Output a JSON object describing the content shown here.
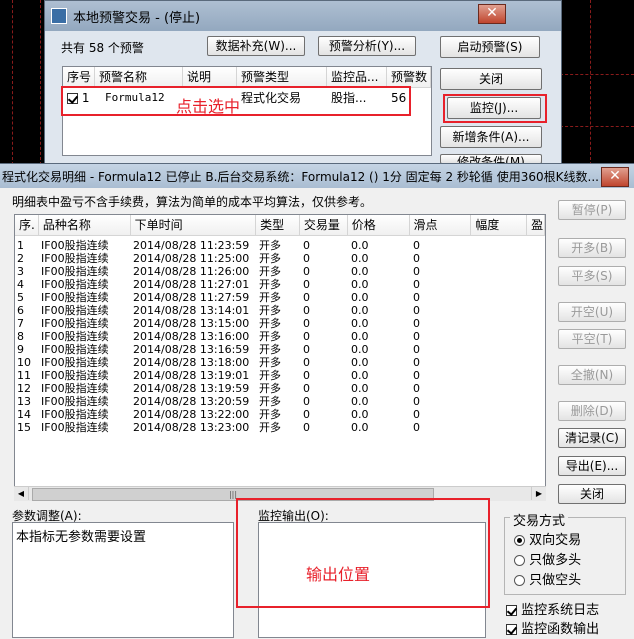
{
  "bg_window": {
    "title": "本地预警交易 - (停止)",
    "count_text": "共有 58 个预警",
    "buttons": {
      "data_fill": "数据补充(W)...",
      "alert_analysis": "预警分析(Y)...",
      "start_alert": "启动预警(S)",
      "close": "关闭",
      "monitor": "监控(J)...",
      "add_condition": "新增条件(A)...",
      "modify_condition": "修改条件(M)"
    },
    "columns": [
      "序号",
      "预警名称",
      "说明",
      "预警类型",
      "监控品...",
      "预警数"
    ],
    "row": {
      "num": "1",
      "name": "Formula12",
      "desc": "",
      "type": "程式化交易",
      "product": "股指...",
      "count": "56"
    },
    "annotation": "点击选中",
    "close_icon": "close-x-icon"
  },
  "fg_window": {
    "title": "程式化交易明细 - Formula12 已停止  B.后台交易系统：Formula12 () 1分 固定每 2 秒轮循 使用360根K线数...",
    "notice": "明细表中盈亏不含手续费，算法为简单的成本平均算法，仅供参考。",
    "columns": [
      "序.",
      "品种名称",
      "下单时间",
      "类型",
      "交易量",
      "价格",
      "滑点",
      "幅度",
      "盈"
    ],
    "rows": [
      [
        "1",
        "IF00股指连续",
        "2014/08/28 11:23:59",
        "开多",
        "0",
        "0.0",
        "0"
      ],
      [
        "2",
        "IF00股指连续",
        "2014/08/28 11:25:00",
        "开多",
        "0",
        "0.0",
        "0"
      ],
      [
        "3",
        "IF00股指连续",
        "2014/08/28 11:26:00",
        "开多",
        "0",
        "0.0",
        "0"
      ],
      [
        "4",
        "IF00股指连续",
        "2014/08/28 11:27:01",
        "开多",
        "0",
        "0.0",
        "0"
      ],
      [
        "5",
        "IF00股指连续",
        "2014/08/28 11:27:59",
        "开多",
        "0",
        "0.0",
        "0"
      ],
      [
        "6",
        "IF00股指连续",
        "2014/08/28 13:14:01",
        "开多",
        "0",
        "0.0",
        "0"
      ],
      [
        "7",
        "IF00股指连续",
        "2014/08/28 13:15:00",
        "开多",
        "0",
        "0.0",
        "0"
      ],
      [
        "8",
        "IF00股指连续",
        "2014/08/28 13:16:00",
        "开多",
        "0",
        "0.0",
        "0"
      ],
      [
        "9",
        "IF00股指连续",
        "2014/08/28 13:16:59",
        "开多",
        "0",
        "0.0",
        "0"
      ],
      [
        "10",
        "IF00股指连续",
        "2014/08/28 13:18:00",
        "开多",
        "0",
        "0.0",
        "0"
      ],
      [
        "11",
        "IF00股指连续",
        "2014/08/28 13:19:01",
        "开多",
        "0",
        "0.0",
        "0"
      ],
      [
        "12",
        "IF00股指连续",
        "2014/08/28 13:19:59",
        "开多",
        "0",
        "0.0",
        "0"
      ],
      [
        "13",
        "IF00股指连续",
        "2014/08/28 13:20:59",
        "开多",
        "0",
        "0.0",
        "0"
      ],
      [
        "14",
        "IF00股指连续",
        "2014/08/28 13:22:00",
        "开多",
        "0",
        "0.0",
        "0"
      ],
      [
        "15",
        "IF00股指连续",
        "2014/08/28 13:23:00",
        "开多",
        "0",
        "0.0",
        "0"
      ]
    ],
    "side_buttons": {
      "pause": "暂停(P)",
      "open_long": "开多(B)",
      "close_long": "平多(S)",
      "open_short": "开空(U)",
      "close_short": "平空(T)",
      "close_all": "全撤(N)",
      "delete": "删除(D)",
      "clear_log": "清记录(C)",
      "export": "导出(E)...",
      "close": "关闭"
    },
    "param_label": "参数调整(A):",
    "param_text": "本指标无参数需要设置",
    "monitor_label": "监控输出(O):",
    "output_annotation": "输出位置",
    "trade_mode": {
      "label": "交易方式",
      "options": [
        "双向交易",
        "只做多头",
        "只做空头"
      ],
      "selected": 0
    },
    "checks": [
      {
        "label": "监控系统日志",
        "checked": true
      },
      {
        "label": "监控函数输出",
        "checked": true
      }
    ],
    "scroll_grip": "|||",
    "colors": {
      "accent_red": "#e8212b",
      "title_blue": "#a9bdd2"
    }
  }
}
